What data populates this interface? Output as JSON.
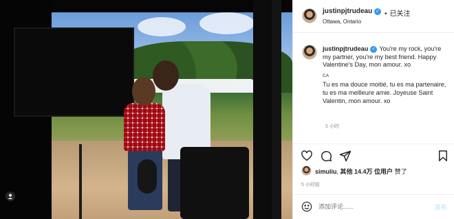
{
  "post": {
    "username": "justinpjtrudeau",
    "follow_label": "已关注",
    "follow_dot": "•",
    "location": "Ottawa, Ontario"
  },
  "caption": {
    "username": "justinpjtrudeau",
    "english": "You're my rock, you're my partner, you're my best friend. Happy Valentine's Day, mon amour. xo",
    "lang_tag": "CA",
    "french": "Tu es ma douce moitié, tu es ma partenaire, tu es ma meilleure amie. Joyeuse Saint Valentin, mon amour. xo",
    "time": "5 小时"
  },
  "actions": {
    "like_icon": "heart-icon",
    "comment_icon": "comment-icon",
    "share_icon": "share-icon",
    "save_icon": "bookmark-icon"
  },
  "likes": {
    "liker": "simuliu",
    "others_label": "其他 14.4万 位用户",
    "suffix": "赞了"
  },
  "post_time": "5 小时前",
  "comment": {
    "placeholder": "添加评论......",
    "post_label": "发布"
  },
  "colors": {
    "verified": "#3897f0",
    "post_button": "#b2dffc",
    "secondary_text": "#8e8e8e"
  }
}
